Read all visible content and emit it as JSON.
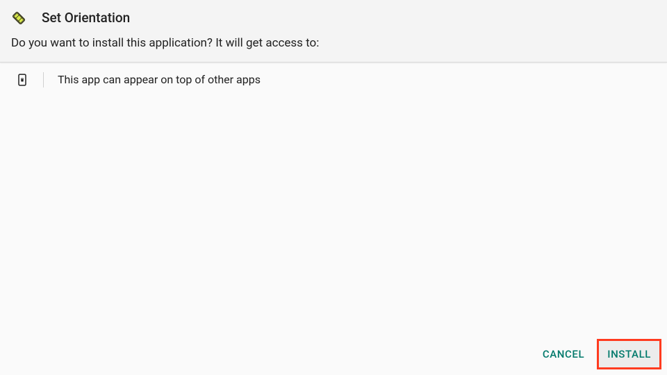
{
  "header": {
    "app_name": "Set Orientation",
    "prompt": "Do you want to install this application? It will get access to:"
  },
  "permissions": [
    {
      "icon": "overlay-icon",
      "text": "This app can appear on top of other apps"
    }
  ],
  "buttons": {
    "cancel": "CANCEL",
    "install": "INSTALL"
  },
  "colors": {
    "accent": "#00796b",
    "highlight_border": "#ff3b1f"
  }
}
